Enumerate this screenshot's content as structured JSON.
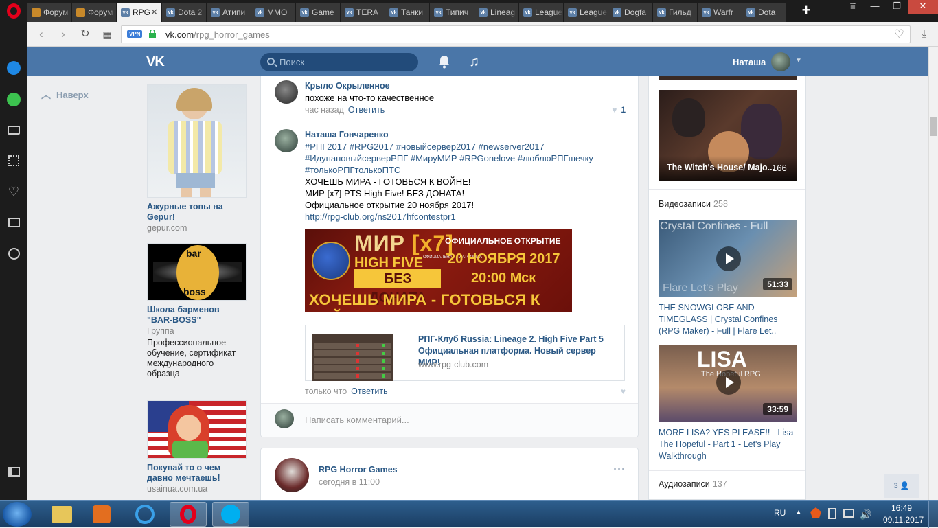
{
  "browser": {
    "tabs": [
      {
        "label": "Форум",
        "icon": "forum"
      },
      {
        "label": "Форум",
        "icon": "forum"
      },
      {
        "label": "RPG",
        "icon": "vk",
        "active": true
      },
      {
        "label": "Dota 2",
        "icon": "vk"
      },
      {
        "label": "Атипи",
        "icon": "vk"
      },
      {
        "label": "ММО",
        "icon": "vk"
      },
      {
        "label": "Game",
        "icon": "vk"
      },
      {
        "label": "TERA",
        "icon": "vk"
      },
      {
        "label": "Танки",
        "icon": "vk"
      },
      {
        "label": "Типич",
        "icon": "vk"
      },
      {
        "label": "Lineag",
        "icon": "vk"
      },
      {
        "label": "League",
        "icon": "vk"
      },
      {
        "label": "League",
        "icon": "vk"
      },
      {
        "label": "Dogfa",
        "icon": "vk"
      },
      {
        "label": "Гильд",
        "icon": "vk"
      },
      {
        "label": "Warfr",
        "icon": "vk"
      },
      {
        "label": "Dota",
        "icon": "vk"
      }
    ],
    "new_tab_label": "+",
    "vpn_badge": "VPN",
    "url_host": "vk.com",
    "url_path": "/rpg_horror_games"
  },
  "vk_header": {
    "logo": "VK",
    "search_placeholder": "Поиск",
    "user_name": "Наташа"
  },
  "left": {
    "back_up": "Наверх",
    "ads": [
      {
        "title": "Ажурные топы на Gepur!",
        "sub": "gepur.com"
      },
      {
        "title": "Школа барменов \"BAR-BOSS\"",
        "sub": "Группа",
        "desc": "Профессиональное обучение, сертификат международного образца"
      },
      {
        "title": "Покупай то о чем давно мечтаешь!",
        "sub": "usainua.com.ua"
      }
    ],
    "ad_logo_text_top": "bar",
    "ad_logo_text_bottom": "boss"
  },
  "feed": {
    "comment1": {
      "author": "Крыло Окрыленное",
      "text": "похоже на что-то качественное",
      "time": "час назад",
      "reply": "Ответить",
      "likes": "1"
    },
    "comment2": {
      "author": "Наташа Гончаренко",
      "hashtags_line1": "#РПГ2017 #RPG2017 #новыйсервер2017 #newserver2017",
      "hashtags_line2": "#ИдунановыйсерверРПГ #МируМИР #RPGonelove #люблюРПГшечку",
      "hashtags_line3": "#толькоРПГтолькоПТС",
      "line1": "ХОЧЕШЬ МИРА - ГОТОВЬСЯ К ВОЙНЕ!",
      "line2": "МИР [x7] PTS High Five! БЕЗ ДОНАТА!",
      "line3": "Официальное открытие 20 ноября 2017!",
      "link": "http://rpg-club.org/ns2017hfcontestpr1",
      "time": "только что",
      "reply": "Ответить"
    },
    "banner": {
      "mir": "МИР",
      "x7": "[x7]",
      "hf": "HIGH FIVE",
      "official_small": "ОФИЦИАЛЬНАЯ ПЛАТФОРМА",
      "nodonate": "БЕЗ ДОНАТА",
      "opening": "ОФИЦИАЛЬНОЕ ОТКРЫТИЕ",
      "date": "20 НОЯБРЯ 2017",
      "time": "20:00 Мск",
      "slogan": "ХОЧЕШЬ МИРА - ГОТОВЬСЯ К ВОЙНЕ"
    },
    "link_card": {
      "title": "РПГ-Клуб Russia: Lineage 2. High Five Part 5 Официальная платформа. Новый сервер МИР!",
      "domain": "www.rpg-club.com"
    },
    "comment_placeholder": "Написать комментарий...",
    "post2": {
      "author": "RPG Horror Games",
      "time": "сегодня в 11:00",
      "menu": "···"
    }
  },
  "right": {
    "album_top": {
      "title": "The Witch's House/ Majo...",
      "count": "166"
    },
    "videos_header": "Видеозаписи",
    "videos_count": "258",
    "videos": [
      {
        "title": "THE SNOWGLOBE AND TIMEGLASS | Crystal Confines (RPG Maker) - Full | Flare Let..",
        "duration": "51:33",
        "thumb_text": "Crystal Confines - Full",
        "thumb_sub": "Flare Let's Play"
      },
      {
        "title": "MORE LISA? YES PLEASE!! - Lisa The Hopeful - Part 1 - Let's Play Walkthrough",
        "duration": "33:59",
        "thumb_text": "LISA",
        "thumb_sub": "The Hopeful RPG"
      }
    ],
    "audio_header": "Аудиозаписи",
    "audio_count": "137"
  },
  "friends_chip": "3",
  "taskbar": {
    "lang": "RU",
    "time": "16:49",
    "date": "09.11.2017"
  }
}
